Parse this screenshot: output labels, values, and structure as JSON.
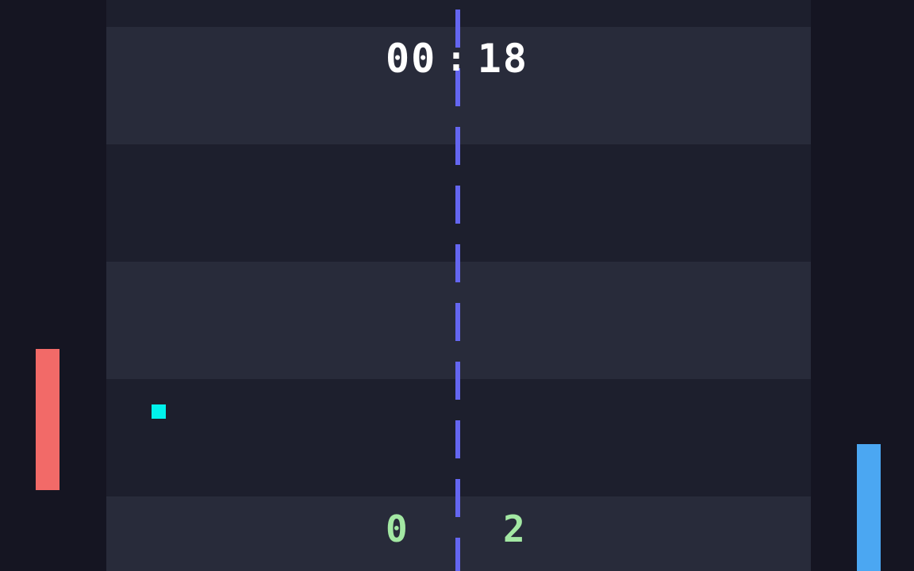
{
  "timer": {
    "minutes": "00",
    "separator": ":",
    "seconds": "18"
  },
  "score": {
    "left": "0",
    "right": "2",
    "color": "#a3e8a3"
  },
  "colors": {
    "background": "#151522",
    "band_light": "#282b3a",
    "band_dark": "#1d1f2d",
    "centerline": "#6466f0",
    "left_paddle": "#f26a68",
    "right_paddle": "#4ba7f2",
    "ball": "#00f2ec"
  }
}
